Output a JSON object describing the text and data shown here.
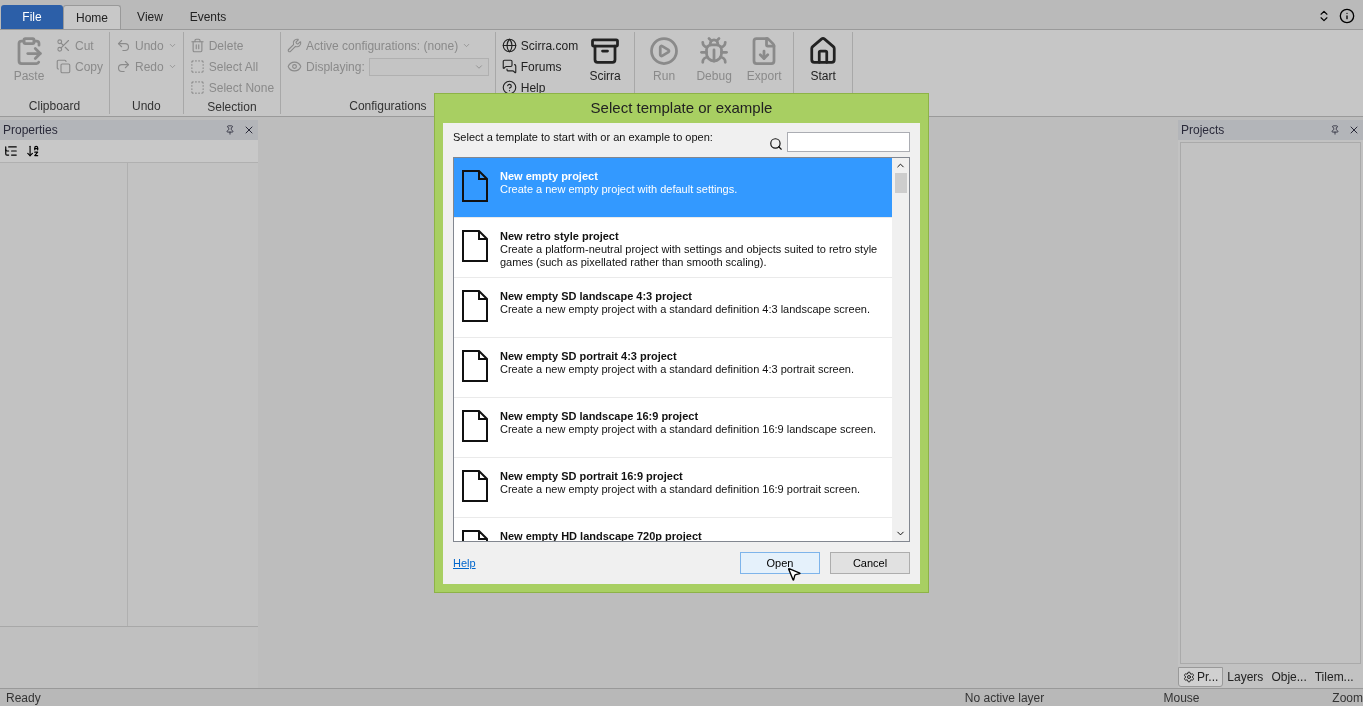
{
  "file_button": "File",
  "menu_tabs": [
    {
      "label": "Home",
      "selected": true
    },
    {
      "label": "View",
      "selected": false
    },
    {
      "label": "Events",
      "selected": false
    }
  ],
  "ribbon": [
    {
      "title": "Clipboard",
      "items": [
        {
          "label": "Paste",
          "kind": "large",
          "disabled": true
        },
        {
          "label": "Cut",
          "kind": "small",
          "disabled": true
        },
        {
          "label": "Copy",
          "kind": "small",
          "disabled": true
        }
      ]
    },
    {
      "title": "Undo",
      "items": [
        {
          "label": "Undo",
          "kind": "dropdown",
          "disabled": true
        },
        {
          "label": "Redo",
          "kind": "dropdown",
          "disabled": true
        }
      ]
    },
    {
      "title": "Selection",
      "items": [
        {
          "label": "Delete",
          "kind": "small",
          "disabled": true
        },
        {
          "label": "Select All",
          "kind": "small",
          "disabled": true
        },
        {
          "label": "Select None",
          "kind": "small",
          "disabled": true
        }
      ]
    },
    {
      "title": "Configurations",
      "items": [
        {
          "label": "Active configurations: (none)",
          "kind": "dropdown",
          "disabled": true
        },
        {
          "label": "Displaying:",
          "kind": "combo",
          "disabled": true
        }
      ]
    },
    {
      "items": [
        {
          "label": "Scirra.com",
          "kind": "small",
          "disabled": false
        },
        {
          "label": "Forums",
          "kind": "small",
          "disabled": false
        },
        {
          "label": "Help",
          "kind": "small",
          "disabled": false
        },
        {
          "label": "Scirra",
          "kind": "large",
          "disabled": false
        }
      ]
    },
    {
      "items": [
        {
          "label": "Run",
          "kind": "large",
          "disabled": true
        },
        {
          "label": "Debug",
          "kind": "large",
          "disabled": true
        },
        {
          "label": "Export",
          "kind": "large",
          "disabled": true
        }
      ]
    },
    {
      "items": [
        {
          "label": "Start",
          "kind": "large",
          "disabled": false
        }
      ]
    }
  ],
  "properties_panel": {
    "title": "Properties"
  },
  "projects_panel": {
    "title": "Projects",
    "tabs": [
      {
        "label": "Pr...",
        "selected": true
      },
      {
        "label": "Layers",
        "selected": false
      },
      {
        "label": "Obje...",
        "selected": false
      },
      {
        "label": "Tilem...",
        "selected": false
      }
    ]
  },
  "status_bar": [
    "Ready",
    "No active layer",
    "Mouse",
    "Zoom"
  ],
  "dialog": {
    "title": "Select template or example",
    "prompt": "Select a template to start with or an example to open:",
    "templates": [
      {
        "name": "New empty project",
        "description": "Create a new empty project with default settings.",
        "selected": true
      },
      {
        "name": "New retro style project",
        "description": "Create a platform-neutral project with settings and objects suited to retro style games (such as pixellated rather than smooth scaling).",
        "selected": false
      },
      {
        "name": "New empty SD landscape 4:3 project",
        "description": "Create a new empty project with a standard definition 4:3 landscape screen.",
        "selected": false
      },
      {
        "name": "New empty SD portrait 4:3 project",
        "description": "Create a new empty project with a standard definition 4:3 portrait screen.",
        "selected": false
      },
      {
        "name": "New empty SD landscape 16:9 project",
        "description": "Create a new empty project with a standard definition 16:9 landscape screen.",
        "selected": false
      },
      {
        "name": "New empty SD portrait 16:9 project",
        "description": "Create a new empty project with a standard definition 16:9 portrait screen.",
        "selected": false
      },
      {
        "name": "New empty HD landscape 720p project",
        "selected": false
      }
    ],
    "help_link": "Help",
    "buttons": [
      {
        "label": "Open",
        "kind": "default"
      },
      {
        "label": "Cancel",
        "kind": "normal"
      }
    ]
  }
}
